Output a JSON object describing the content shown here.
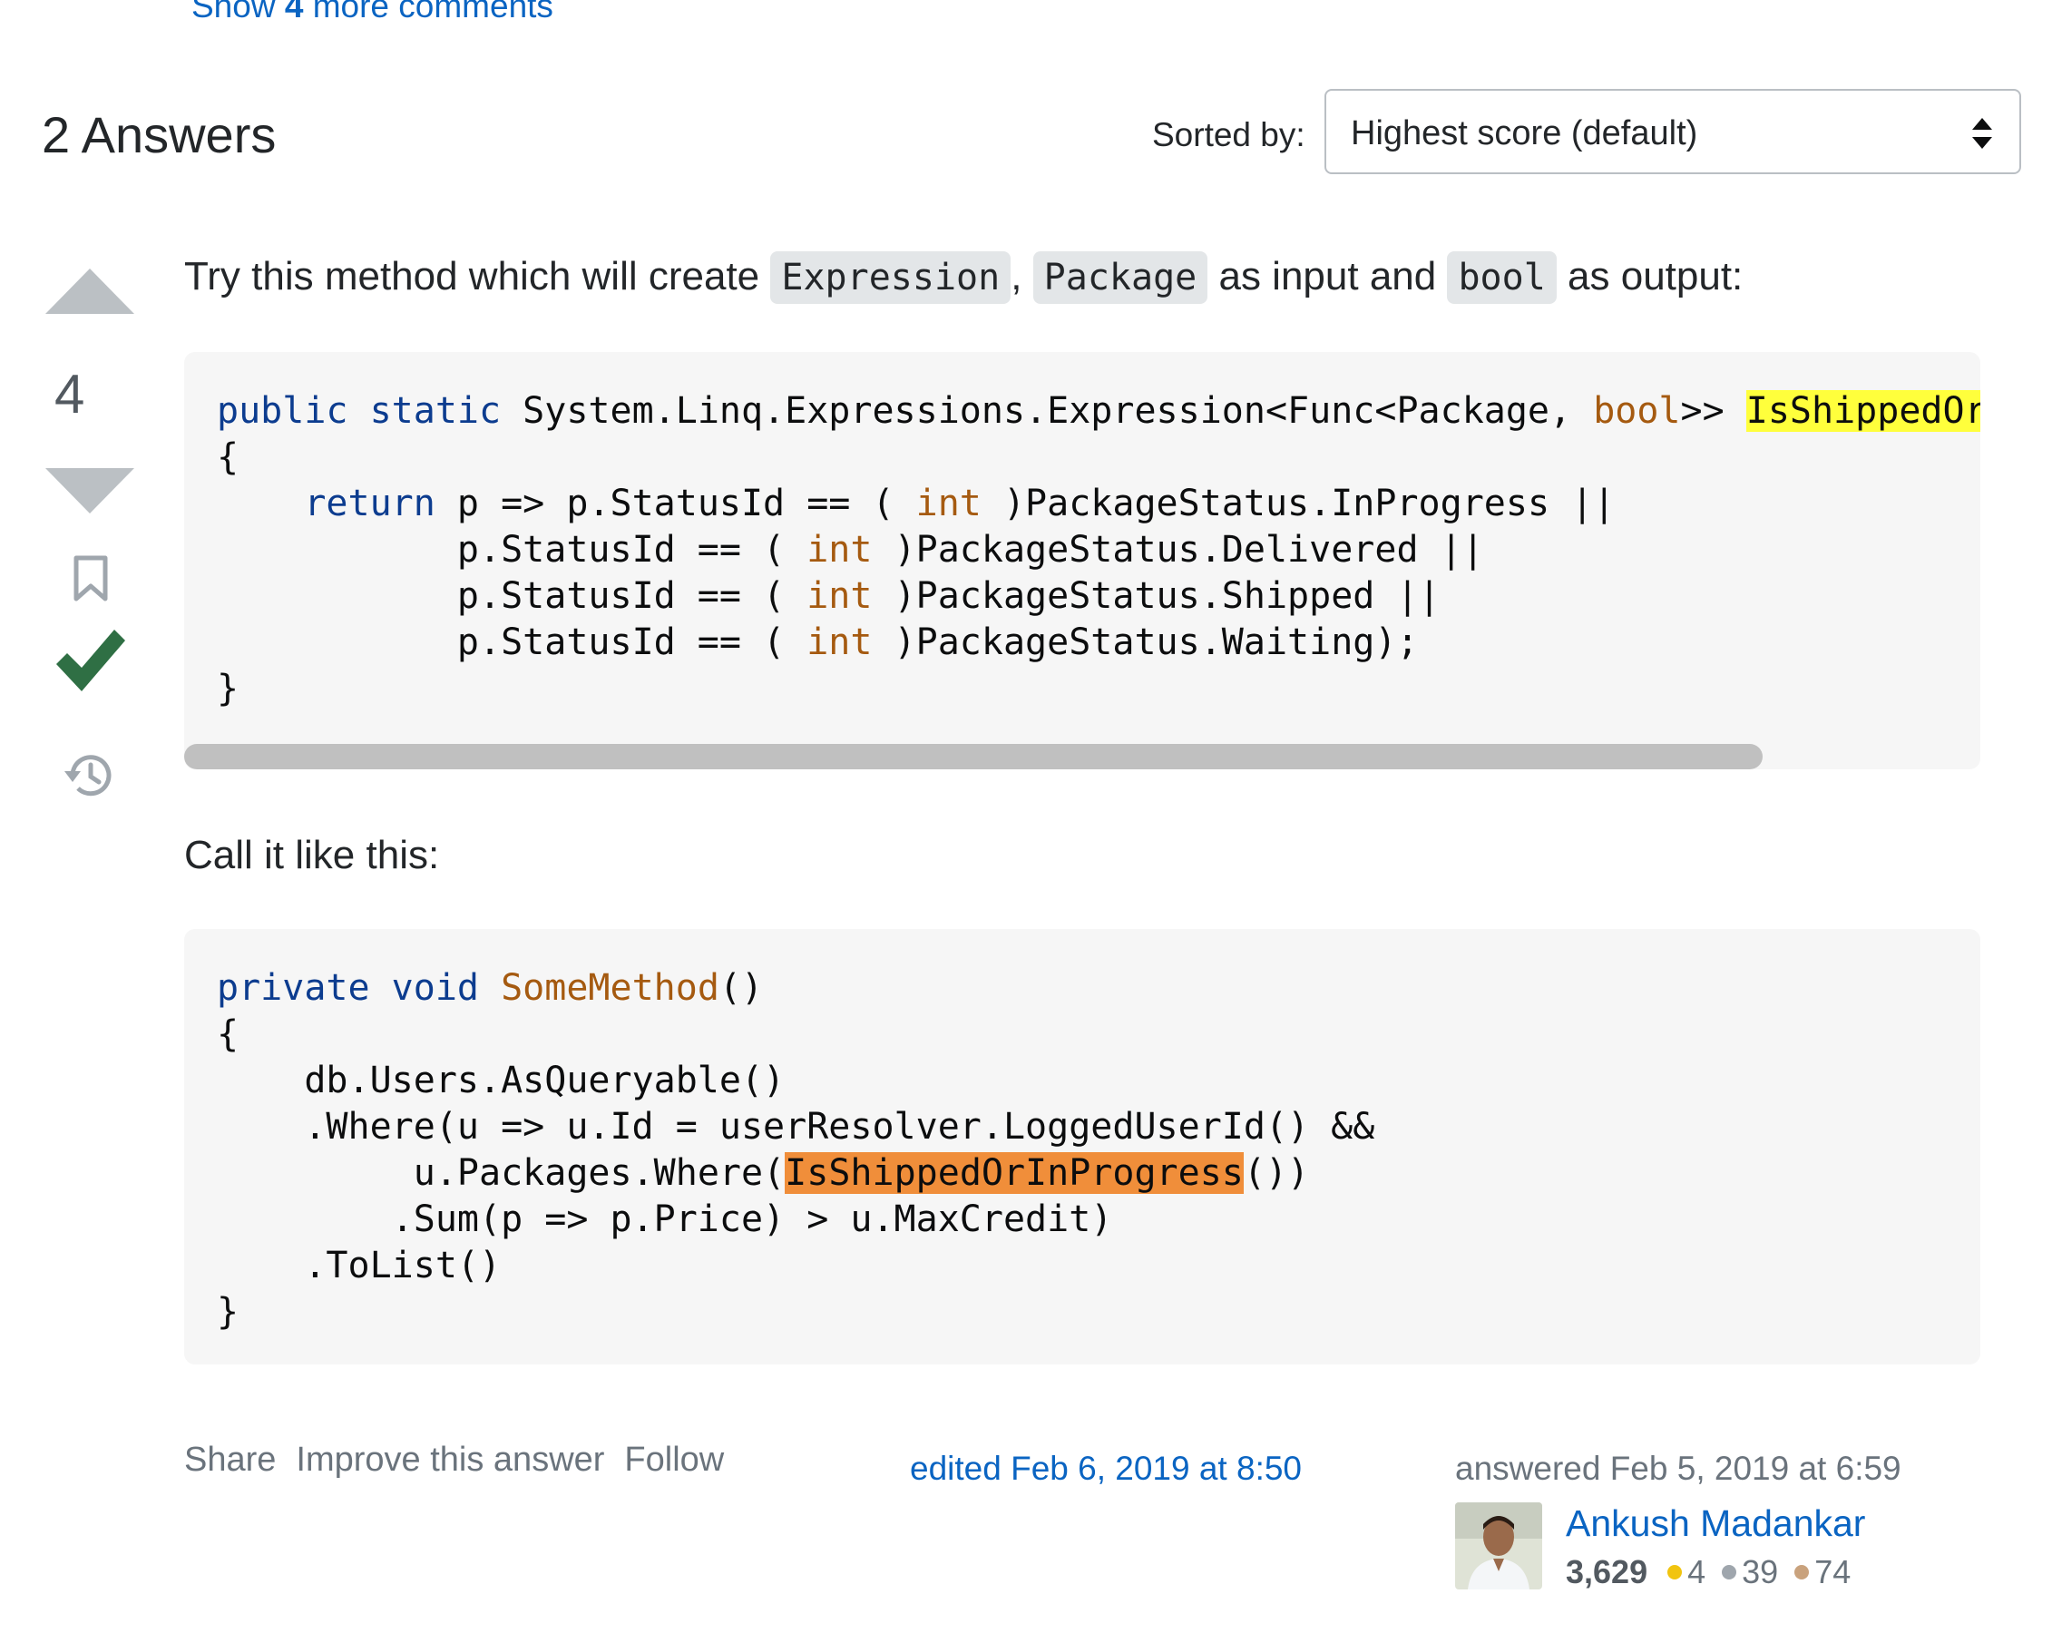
{
  "comments": {
    "show_prefix": "Show",
    "count": "4",
    "show_suffix": "more comments"
  },
  "answers": {
    "title": "2 Answers",
    "sort_label": "Sorted by:",
    "sort_value": "Highest score (default)"
  },
  "vote": {
    "count": "4"
  },
  "post": {
    "intro_1": "Try this method which will create",
    "code_expression": "Expression",
    "comma": ",",
    "code_package": "Package",
    "intro_2": "as input and",
    "code_bool": "bool",
    "intro_3": "as output:",
    "code1": {
      "l1_kw": "public static",
      "l1_mid": " System.Linq.Expressions.Expression<Func<Package, ",
      "l1_bool": "bool",
      "l1_end": ">> ",
      "l1_hl": "IsShippedOrIr",
      "l2": "{",
      "l3_kw": "return",
      "l3_a": " p => p.StatusId == ( ",
      "l3_int": "int",
      "l3_b": " )PackageStatus.InProgress ||",
      "l4_a": "p.StatusId == ( ",
      "l4_int": "int",
      "l4_b": " )PackageStatus.Delivered ||",
      "l5_a": "p.StatusId == ( ",
      "l5_int": "int",
      "l5_b": " )PackageStatus.Shipped ||",
      "l6_a": "p.StatusId == ( ",
      "l6_int": "int",
      "l6_b": " )PackageStatus.Waiting);",
      "l7": "}"
    },
    "call_text": "Call it like this:",
    "code2": {
      "l1_kw": "private void",
      "l1_method": "SomeMethod",
      "l1_end": "()",
      "l2": "{",
      "l3": "db.Users.AsQueryable()",
      "l4": ".Where(u => u.Id = userResolver.LoggedUserId() &&",
      "l5_a": "u.Packages.Where(",
      "l5_hl": "IsShippedOrInProgress",
      "l5_b": "())",
      "l6": ".Sum(p => p.Price) > u.MaxCredit)",
      "l7": ".ToList()",
      "l8": "}"
    }
  },
  "menu": {
    "share": "Share",
    "improve": "Improve this answer",
    "follow": "Follow"
  },
  "edited": "edited Feb 6, 2019 at 8:50",
  "answered": "answered Feb 5, 2019 at 6:59",
  "user": {
    "name": "Ankush Madankar",
    "reputation": "3,629",
    "gold": "4",
    "silver": "39",
    "bronze": "74"
  },
  "colors": {
    "link": "#0a64c2",
    "keyword": "#0c3c8f",
    "type": "#a55a10",
    "accepted": "#2f6f44",
    "highlight_yellow": "#ffff3c",
    "highlight_orange": "#f08e3a"
  }
}
